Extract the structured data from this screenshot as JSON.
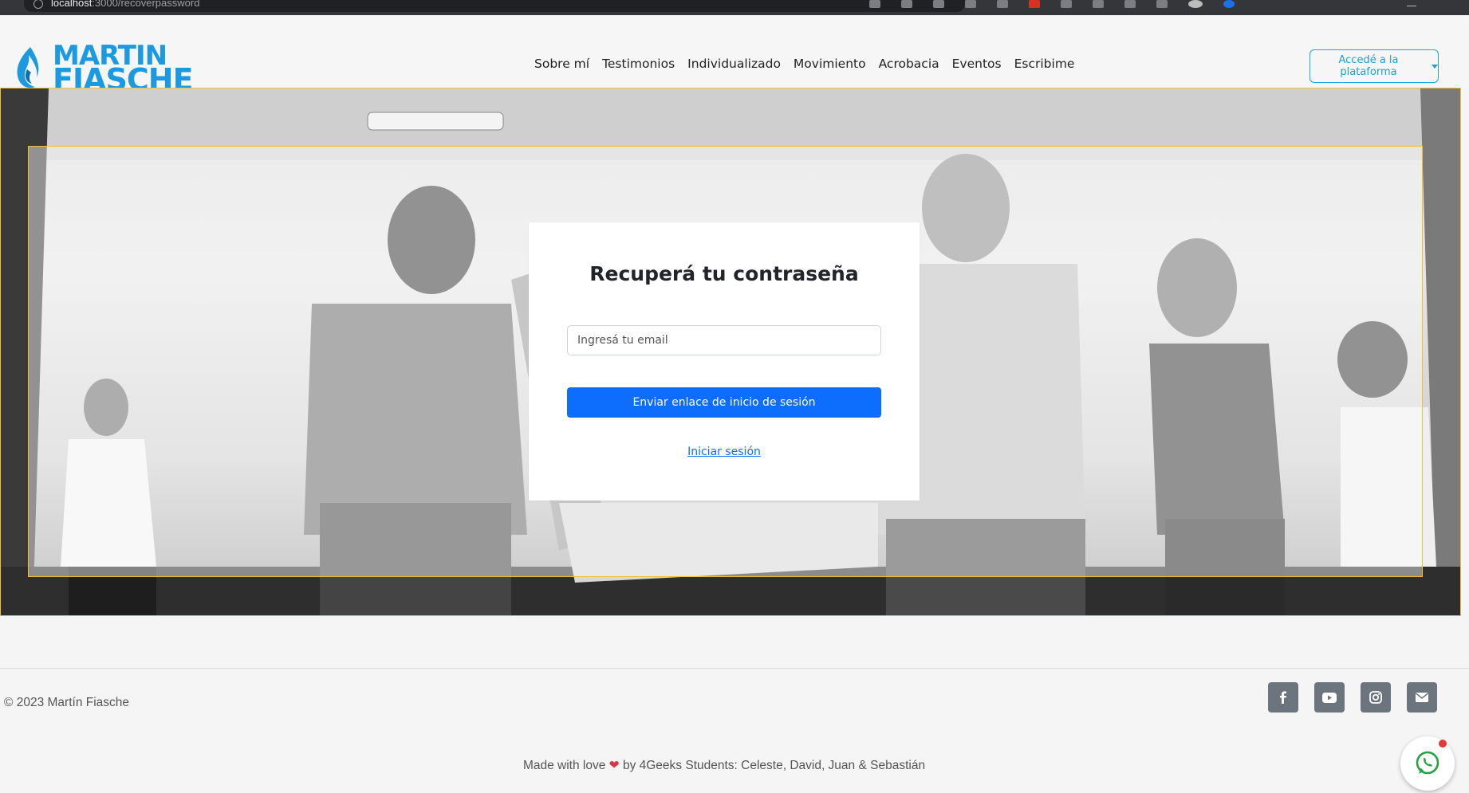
{
  "browser": {
    "url_host": "localhost",
    "url_rest": ":3000/recoverpassword"
  },
  "brand": {
    "line1": "MARTIN",
    "line2": "FIASCHE",
    "color": "#1b9ae2"
  },
  "nav": {
    "links": [
      "Sobre mí",
      "Testimonios",
      "Individualizado",
      "Movimiento",
      "Acrobacia",
      "Eventos",
      "Escribime"
    ],
    "platform_button": "Accedé a la plataforma"
  },
  "recover": {
    "title": "Recuperá tu contraseña",
    "email_placeholder": "Ingresá tu email",
    "send_button": "Enviar enlace de inicio de sesión",
    "login_link": "Iniciar sesión"
  },
  "footer": {
    "copyright": "© 2023 Martín Fiasche",
    "socials": [
      "facebook-icon",
      "youtube-icon",
      "instagram-icon",
      "envelope-icon"
    ],
    "made_prefix": "Made with love",
    "made_suffix": "by 4Geeks Students: Celeste, David, Juan & Sebastián"
  },
  "colors": {
    "primary_button": "#0d6efd",
    "hero_border": "#f0c030",
    "social_button": "#6c757d"
  }
}
